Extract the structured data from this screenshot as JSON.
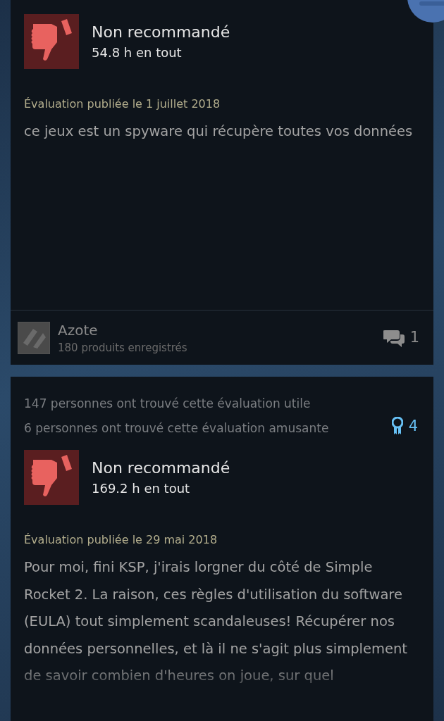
{
  "reviews": [
    {
      "recommended": false,
      "verdict": "Non recommandé",
      "hours": "54.8 h en tout",
      "date": "Évaluation publiée le 1 juillet 2018",
      "body": "ce jeux est un spyware qui récupère toutes vos données",
      "author": {
        "name": "Azote",
        "products": "180 produits enregistrés"
      },
      "comments": "1"
    },
    {
      "helpful": [
        "147 personnes ont trouvé cette évaluation utile",
        "6 personnes ont trouvé cette évaluation amusante"
      ],
      "awards": "4",
      "recommended": false,
      "verdict": "Non recommandé",
      "hours": "169.2 h en tout",
      "date": "Évaluation publiée le 29 mai 2018",
      "body": "Pour moi, fini KSP, j'irais lorgner du côté de Simple Rocket 2. La raison, ces règles d'utilisation du software (EULA) tout simplement scandaleuses! Récupérer nos données personnelles, et là il ne s'agit plus simplement de savoir combien d'heures on joue, sur quel"
    }
  ]
}
